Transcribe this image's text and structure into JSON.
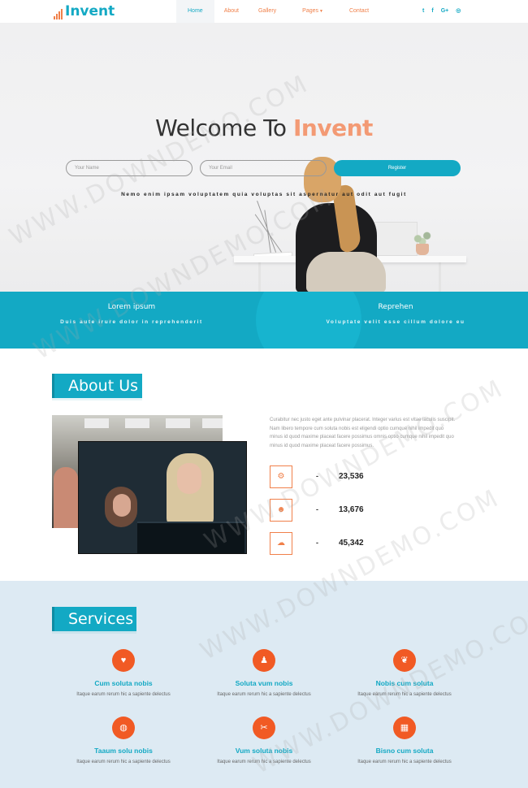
{
  "nav": {
    "brand": "Invent",
    "items": [
      {
        "label": "Home",
        "active": true
      },
      {
        "label": "About"
      },
      {
        "label": "Gallery"
      },
      {
        "label": "Pages"
      },
      {
        "label": "Contact"
      }
    ],
    "social": [
      "twitter-icon",
      "facebook-icon",
      "google-plus-icon",
      "dribbble-icon"
    ],
    "social_glyphs": [
      "t",
      "f",
      "G+",
      "◎"
    ]
  },
  "hero": {
    "title_prefix": "Welcome To ",
    "title_accent": "Invent",
    "name_placeholder": "Your Name",
    "email_placeholder": "Your Email",
    "register_label": "Register",
    "subtitle": "Nemo enim ipsam voluptatem quia voluptas sit aspernatur aut odit aut fugit"
  },
  "band": {
    "left": {
      "title": "Lorem ipsum",
      "text": "Duis aute irure dolor in reprehenderit"
    },
    "right": {
      "title": "Reprehen",
      "text": "Voluptate velit esse cillum dolore eu"
    }
  },
  "about": {
    "title": "About Us",
    "text": "Curabitur nec justo eget ante pulvinar placerat. Integer varius est vitae iaculis suscipit. Nam libero tempore cum soluta nobis est eligendi optio cumque nihil impedit quo minus id quod maxime placeat facere possimus omnis optio cumque nihil impedit quo minus id quod maxime placeat facere possimus.",
    "stats": [
      {
        "icon": "gears-icon",
        "glyph": "⚙",
        "dash": "-",
        "value": "23,536"
      },
      {
        "icon": "users-icon",
        "glyph": "☻",
        "dash": "-",
        "value": "13,676"
      },
      {
        "icon": "cloud-icon",
        "glyph": "☁",
        "dash": "-",
        "value": "45,342"
      }
    ]
  },
  "services": {
    "title": "Services",
    "items": [
      {
        "icon": "heart-icon",
        "glyph": "♥",
        "name": "Cum soluta nobis",
        "desc": "Itaque earum rerum hic a sapiente delectus"
      },
      {
        "icon": "user-icon",
        "glyph": "♟",
        "name": "Soluta vum nobis",
        "desc": "Itaque earum rerum hic a sapiente delectus"
      },
      {
        "icon": "leaf-icon",
        "glyph": "❦",
        "name": "Nobis cum soluta",
        "desc": "Itaque earum rerum hic a sapiente delectus"
      },
      {
        "icon": "globe-icon",
        "glyph": "◍",
        "name": "Taaum solu nobis",
        "desc": "Itaque earum rerum hic a sapiente delectus"
      },
      {
        "icon": "cutlery-icon",
        "glyph": "✂",
        "name": "Vum soluta nobis",
        "desc": "Itaque earum rerum hic a sapiente delectus"
      },
      {
        "icon": "grid-icon",
        "glyph": "▦",
        "name": "Bisno cum soluta",
        "desc": "Itaque earum rerum hic a sapiente delectus"
      }
    ]
  },
  "watermark": "WWW.DOWNDEMO.COM",
  "colors": {
    "accent": "#13a9c4",
    "orange": "#f0804a",
    "service_icon": "#f15a24"
  }
}
